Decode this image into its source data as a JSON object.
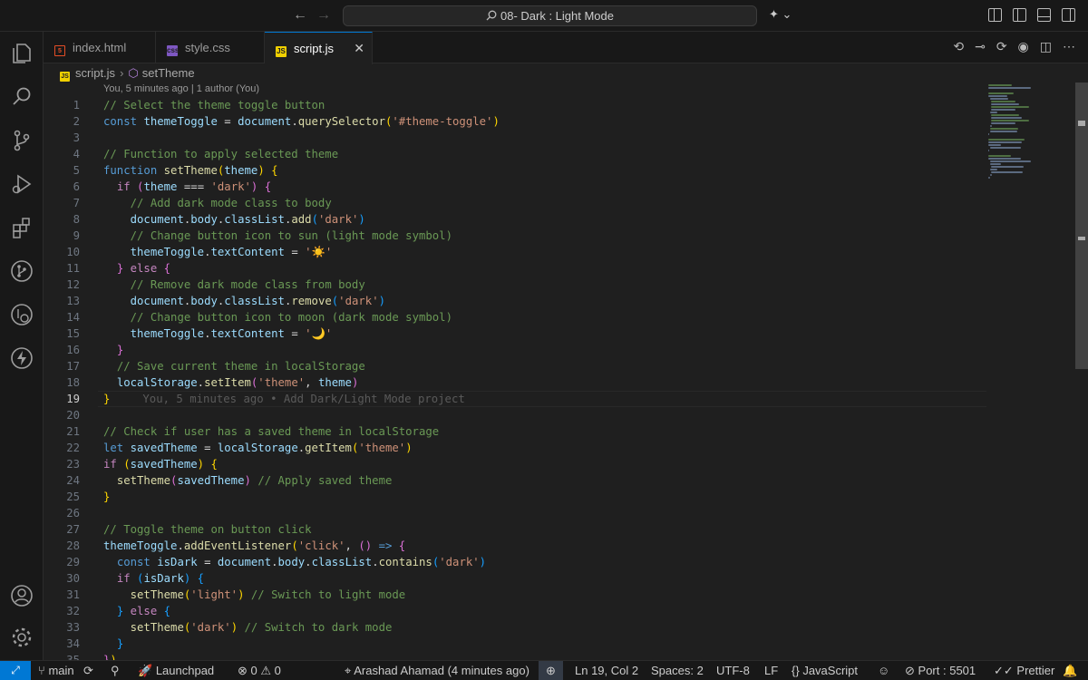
{
  "titlebar": {
    "search_text": "08- Dark : Light Mode"
  },
  "tabs": [
    {
      "label": "index.html",
      "icon": "html-file-icon"
    },
    {
      "label": "style.css",
      "icon": "css-file-icon"
    },
    {
      "label": "script.js",
      "icon": "js-file-icon",
      "active": true
    }
  ],
  "breadcrumb": {
    "file": "script.js",
    "symbol": "setTheme"
  },
  "codelens": "You, 5 minutes ago | 1 author (You)",
  "blame": "You, 5 minutes ago • Add Dark/Light Mode project",
  "current_line": 19,
  "code_lines": [
    "// Select the theme toggle button",
    "const themeToggle = document.querySelector('#theme-toggle')",
    "",
    "// Function to apply selected theme",
    "function setTheme(theme) {",
    "  if (theme === 'dark') {",
    "    // Add dark mode class to body",
    "    document.body.classList.add('dark')",
    "    // Change button icon to sun (light mode symbol)",
    "    themeToggle.textContent = '☀️'",
    "  } else {",
    "    // Remove dark mode class from body",
    "    document.body.classList.remove('dark')",
    "    // Change button icon to moon (dark mode symbol)",
    "    themeToggle.textContent = '🌙'",
    "  }",
    "  // Save current theme in localStorage",
    "  localStorage.setItem('theme', theme)",
    "}",
    "",
    "// Check if user has a saved theme in localStorage",
    "let savedTheme = localStorage.getItem('theme')",
    "if (savedTheme) {",
    "  setTheme(savedTheme) // Apply saved theme",
    "}",
    "",
    "// Toggle theme on button click",
    "themeToggle.addEventListener('click', () => {",
    "  const isDark = document.body.classList.contains('dark')",
    "  if (isDark) {",
    "    setTheme('light') // Switch to light mode",
    "  } else {",
    "    setTheme('dark') // Switch to dark mode",
    "  }",
    "})"
  ],
  "statusbar": {
    "branch": "main",
    "launchpad": "Launchpad",
    "errors": "0",
    "warnings": "0",
    "blame": "Arashad Ahamad (4 minutes ago)",
    "position": "Ln 19, Col 2",
    "spaces": "Spaces: 2",
    "encoding": "UTF-8",
    "eol": "LF",
    "language": "JavaScript",
    "port": "Port : 5501",
    "prettier": "Prettier"
  },
  "colors": {
    "accent": "#0078d4",
    "comment": "#6a9955",
    "string": "#ce9178",
    "keyword": "#569cd6",
    "variable": "#9cdcfe",
    "function": "#dcdcaa"
  }
}
